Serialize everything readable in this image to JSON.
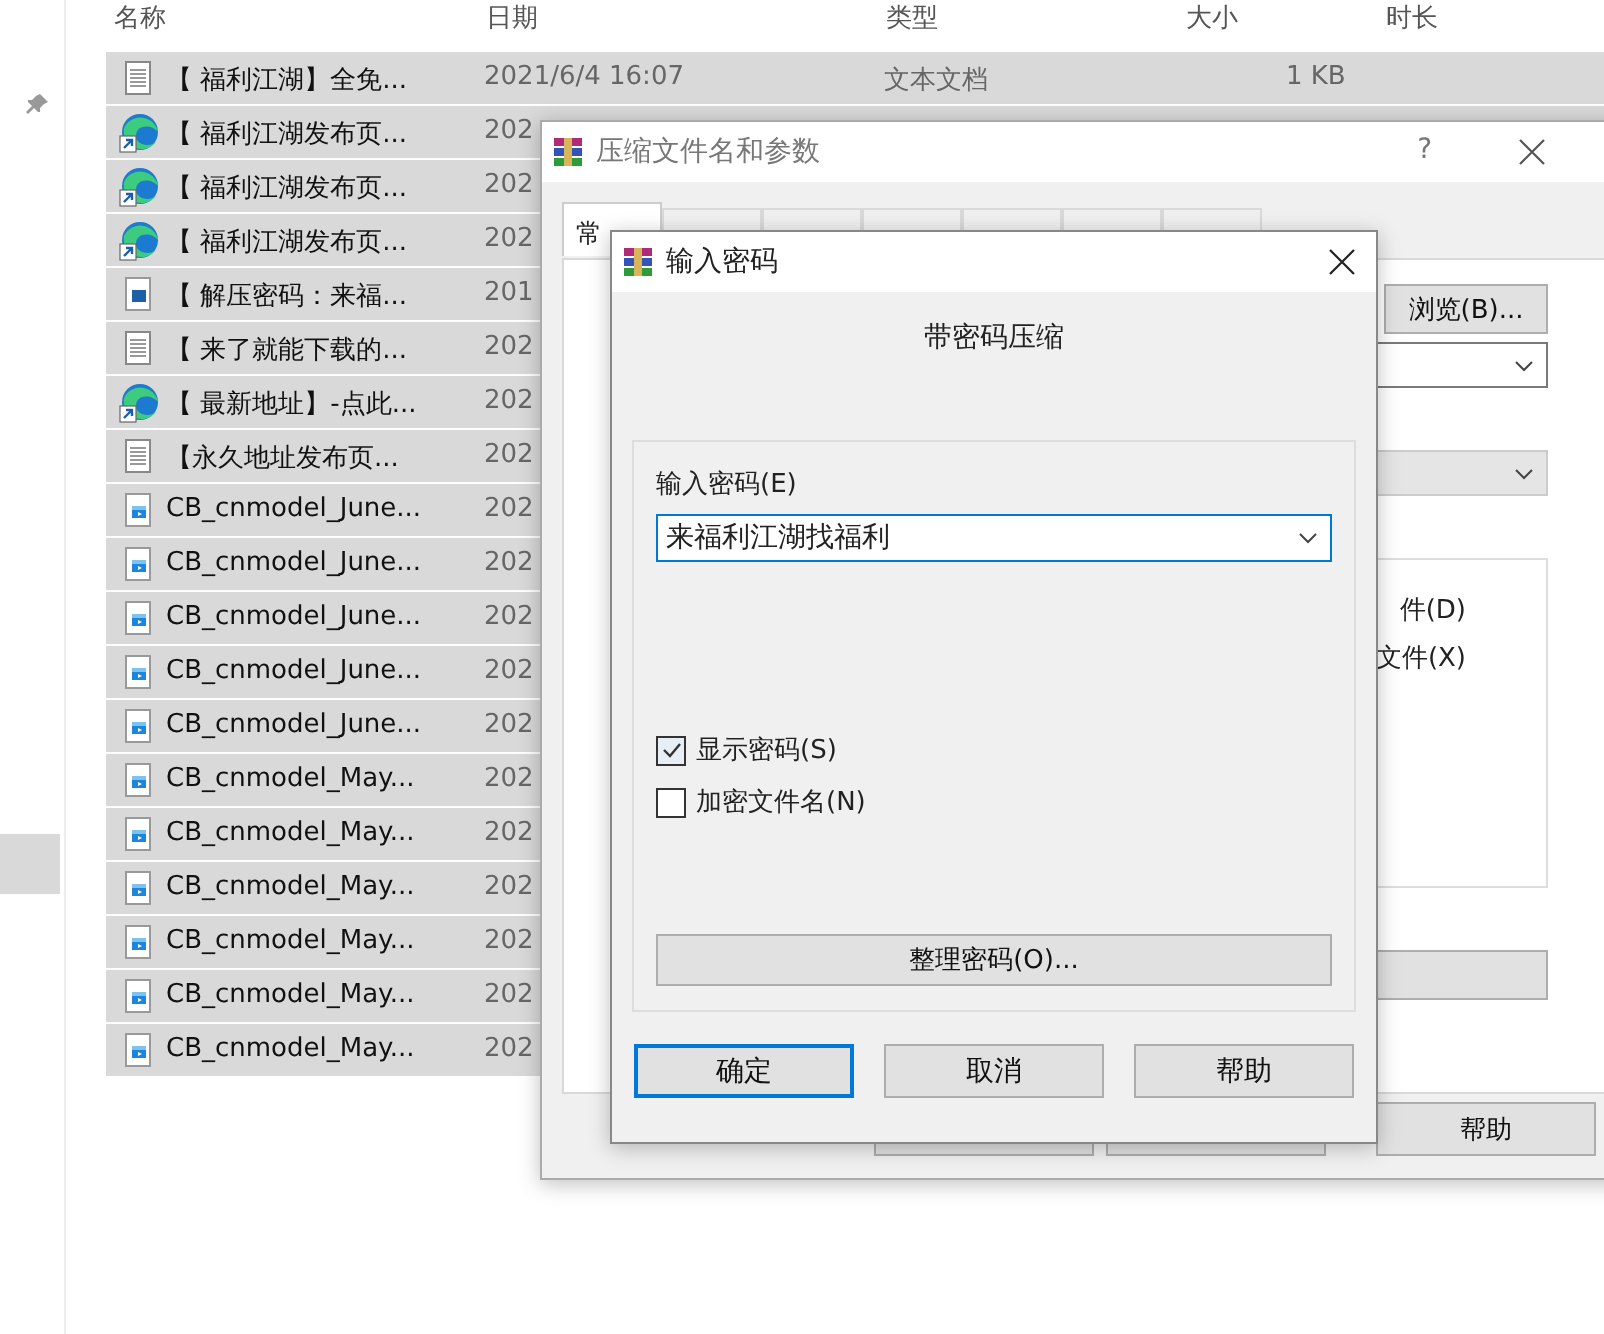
{
  "explorer": {
    "columns": [
      "名称",
      "日期",
      "类型",
      "大小",
      "时长"
    ],
    "rows": [
      {
        "kind": "text",
        "name": "【 福利江湖】全免...",
        "date": "2021/6/4 16:07",
        "type": "文本文档",
        "size": "1 KB",
        "selected": true
      },
      {
        "kind": "edge",
        "name": "【 福利江湖发布页...",
        "date": "202",
        "selected": true
      },
      {
        "kind": "edge",
        "name": "【 福利江湖发布页...",
        "date": "202",
        "selected": true
      },
      {
        "kind": "edge",
        "name": "【 福利江湖发布页...",
        "date": "202",
        "selected": true
      },
      {
        "kind": "image",
        "name": "【 解压密码：来福...",
        "date": "201",
        "selected": true
      },
      {
        "kind": "text",
        "name": "【 来了就能下载的...",
        "date": "202",
        "selected": true
      },
      {
        "kind": "edge",
        "name": "【 最新地址】-点此...",
        "date": "202",
        "selected": true
      },
      {
        "kind": "text",
        "name": "【永久地址发布页...",
        "date": "202",
        "selected": true
      },
      {
        "kind": "media",
        "name": "CB_cnmodel_June...",
        "date": "202",
        "selected": true
      },
      {
        "kind": "media",
        "name": "CB_cnmodel_June...",
        "date": "202",
        "selected": true
      },
      {
        "kind": "media",
        "name": "CB_cnmodel_June...",
        "date": "202",
        "selected": true
      },
      {
        "kind": "media",
        "name": "CB_cnmodel_June...",
        "date": "202",
        "selected": true
      },
      {
        "kind": "media",
        "name": "CB_cnmodel_June...",
        "date": "202",
        "selected": true
      },
      {
        "kind": "media",
        "name": "CB_cnmodel_May...",
        "date": "202",
        "selected": true
      },
      {
        "kind": "media",
        "name": "CB_cnmodel_May...",
        "date": "202",
        "selected": true
      },
      {
        "kind": "media",
        "name": "CB_cnmodel_May...",
        "date": "202",
        "selected": true
      },
      {
        "kind": "media",
        "name": "CB_cnmodel_May...",
        "date": "202",
        "selected": true
      },
      {
        "kind": "media",
        "name": "CB_cnmodel_May...",
        "date": "202",
        "selected": true
      },
      {
        "kind": "media",
        "name": "CB_cnmodel_May...",
        "date": "202",
        "selected": true
      }
    ]
  },
  "archive_dialog": {
    "title": "压缩文件名和参数",
    "help_glyph": "?",
    "tabs": [
      {
        "label": "常",
        "selected": true
      },
      {
        "selected": false
      },
      {
        "selected": false
      },
      {
        "selected": false
      },
      {
        "selected": false
      },
      {
        "selected": false
      },
      {
        "selected": false
      }
    ],
    "browse_button": "浏览(B)...",
    "option_texts": [
      "件(D)",
      "文件(X)"
    ],
    "help_button": "帮助"
  },
  "password_dialog": {
    "title": "输入密码",
    "heading": "带密码压缩",
    "password_label": "输入密码(E)",
    "password_value": "来福利江湖找福利",
    "options": [
      {
        "label": "显示密码(S)",
        "checked": true
      },
      {
        "label": "加密文件名(N)",
        "checked": false
      }
    ],
    "organize_button": "整理密码(O)...",
    "buttons": [
      {
        "label": "确定",
        "default": true
      },
      {
        "label": "取消",
        "default": false
      },
      {
        "label": "帮助",
        "default": false
      }
    ]
  }
}
